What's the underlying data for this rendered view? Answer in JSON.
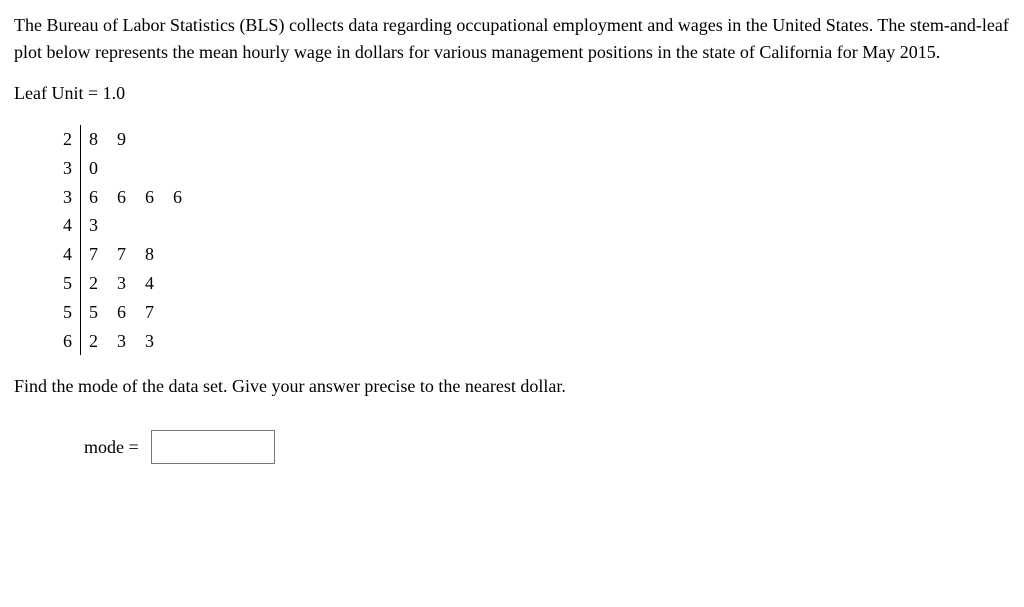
{
  "intro": "The Bureau of Labor Statistics (BLS) collects data regarding occupational employment and wages in the United States. The stem-and-leaf plot below represents the mean hourly wage in dollars for various management positions in the state of California for May 2015.",
  "leaf_unit": "Leaf Unit = 1.0",
  "stem_leaf": {
    "rows": [
      {
        "stem": "2",
        "leaves": [
          "8",
          "9"
        ]
      },
      {
        "stem": "3",
        "leaves": [
          "0"
        ]
      },
      {
        "stem": "3",
        "leaves": [
          "6",
          "6",
          "6",
          "6"
        ]
      },
      {
        "stem": "4",
        "leaves": [
          "3"
        ]
      },
      {
        "stem": "4",
        "leaves": [
          "7",
          "7",
          "8"
        ]
      },
      {
        "stem": "5",
        "leaves": [
          "2",
          "3",
          "4"
        ]
      },
      {
        "stem": "5",
        "leaves": [
          "5",
          "6",
          "7"
        ]
      },
      {
        "stem": "6",
        "leaves": [
          "2",
          "3",
          "3"
        ]
      }
    ]
  },
  "question": "Find the mode of the data set. Give your answer precise to the nearest dollar.",
  "answer_label": "mode =",
  "answer_value": "",
  "chart_data": {
    "type": "table",
    "title": "Stem-and-leaf plot of mean hourly wage ($), CA management positions, May 2015",
    "leaf_unit": 1.0,
    "values": [
      28,
      29,
      30,
      36,
      36,
      36,
      36,
      43,
      47,
      47,
      48,
      52,
      53,
      54,
      55,
      56,
      57,
      62,
      63,
      63
    ]
  }
}
